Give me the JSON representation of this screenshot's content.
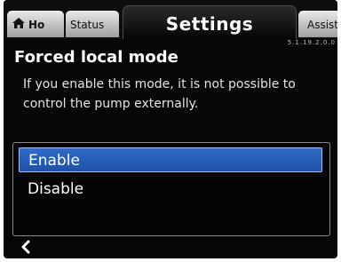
{
  "tabs": {
    "home": "Ho",
    "status": "Status",
    "settings": "Settings",
    "assist": "Assist"
  },
  "version": "5.1.19.2.0.0",
  "screen": {
    "title": "Forced local mode",
    "description": "If you enable this mode, it is not possible to control the pump externally."
  },
  "options": {
    "items": [
      "Enable",
      "Disable"
    ],
    "selected": "Enable"
  },
  "colors": {
    "background": "#070707",
    "selection": "#2a5fb8"
  },
  "icons": {
    "home": "home-icon",
    "back": "chevron-left-icon"
  }
}
